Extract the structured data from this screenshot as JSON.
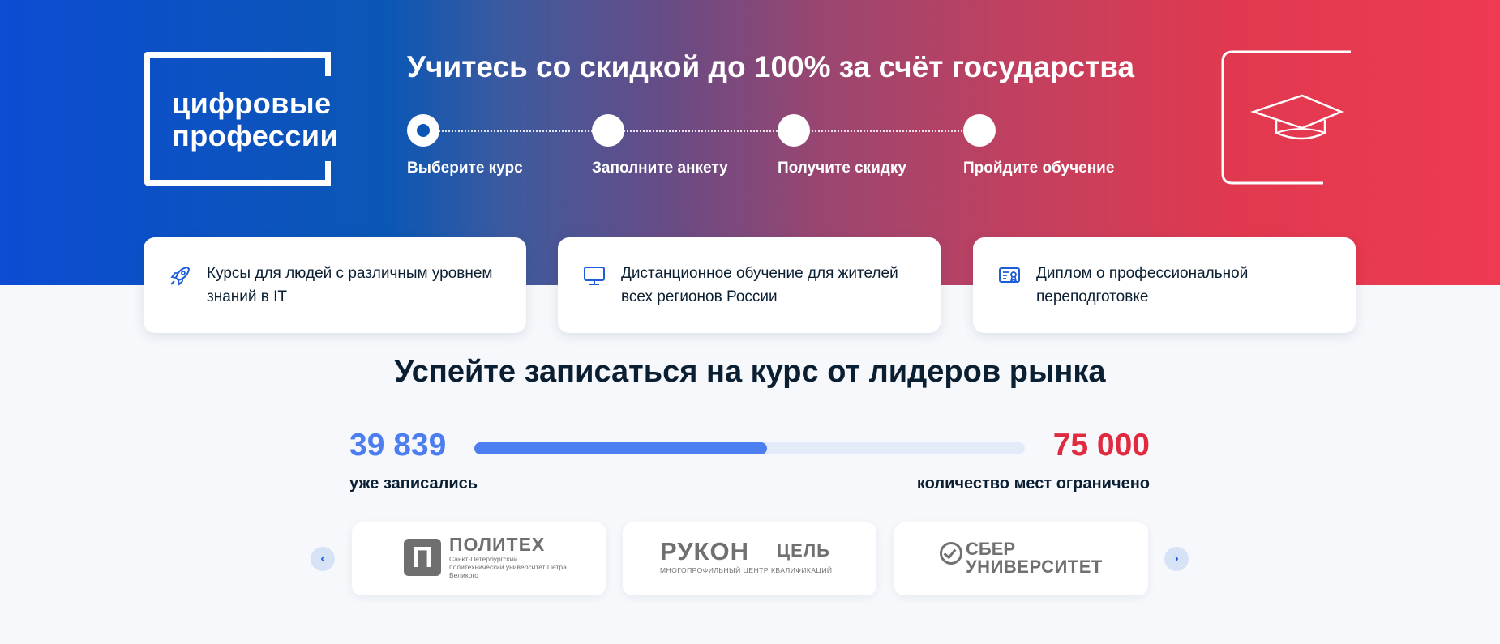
{
  "logo": {
    "line1": "цифровые",
    "line2": "профессии"
  },
  "hero": {
    "title": "Учитесь со скидкой до 100% за счёт государства"
  },
  "steps": [
    {
      "label": "Выберите курс",
      "active": true
    },
    {
      "label": "Заполните анкету",
      "active": false
    },
    {
      "label": "Получите скидку",
      "active": false
    },
    {
      "label": "Пройдите обучение",
      "active": false
    }
  ],
  "features": [
    {
      "icon": "rocket-icon",
      "text": "Курсы для людей с различным уровнем знаний в IT"
    },
    {
      "icon": "monitor-icon",
      "text": "Дистанционное обучение для жителей всех регионов России"
    },
    {
      "icon": "diploma-icon",
      "text": "Диплом о профессиональной переподготовке"
    }
  ],
  "section": {
    "title": "Успейте записаться на курс от лидеров рынка"
  },
  "enrollment": {
    "enrolled_value": "39 839",
    "enrolled_label": "уже записались",
    "capacity_value": "75 000",
    "capacity_label": "количество мест ограничено",
    "progress_fraction": 0.531
  },
  "carousel": {
    "prev_icon": "chevron-left-icon",
    "next_icon": "chevron-right-icon",
    "prev_symbol": "‹",
    "next_symbol": "›",
    "partners": [
      {
        "mark": "П",
        "name": "ПОЛИТЕХ",
        "subtitle": "Санкт-Петербургский политехнический университет Петра Великого"
      },
      {
        "name": "РУКОН",
        "name2": "ЦЕЛЬ",
        "subtitle": "МНОГОПРОФИЛЬНЫЙ ЦЕНТР КВАЛИФИКАЦИЙ"
      },
      {
        "name": "СБЕР",
        "name2": "УНИВЕРСИТЕТ"
      }
    ]
  },
  "colors": {
    "accent_blue": "#4c7ef0",
    "accent_red": "#e02a3f",
    "hero_start": "#0d4cd3",
    "hero_end": "#ee3a52"
  }
}
